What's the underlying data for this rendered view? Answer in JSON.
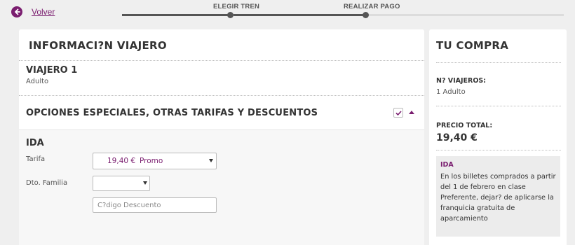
{
  "nav": {
    "back_label": "Volver",
    "steps": [
      {
        "label": "ELEGIR TREN"
      },
      {
        "label": "REALIZAR PAGO"
      }
    ]
  },
  "main": {
    "title": "INFORMACI?N VIAJERO",
    "traveler": {
      "title": "VIAJERO 1",
      "type": "Adulto"
    },
    "options": {
      "title": "OPCIONES ESPECIALES, OTRAS TARIFAS Y DESCUENTOS",
      "checked": true
    },
    "ida": {
      "label": "IDA",
      "tarifa_label": "Tarifa",
      "tarifa_price": "19,40 €",
      "tarifa_name": "Promo",
      "familia_label": "Dto. Familia",
      "familia_value": "",
      "discount_code_placeholder": "C?digo Descuento"
    }
  },
  "summary": {
    "title": "TU COMPRA",
    "travelers_label": "N? VIAJEROS:",
    "travelers_value": "1 Adulto",
    "total_label": "PRECIO TOTAL:",
    "total_value": "19,40 €",
    "note": {
      "title": "IDA",
      "text": "En los billetes comprados a partir del 1 de febrero en clase Preferente, dejar? de aplicarse la franquicia gratuita de aparcamiento"
    }
  },
  "colors": {
    "accent": "#7a1d6f",
    "background": "#efefef",
    "step_done": "#555555",
    "step_pending": "#dcdcdc"
  }
}
